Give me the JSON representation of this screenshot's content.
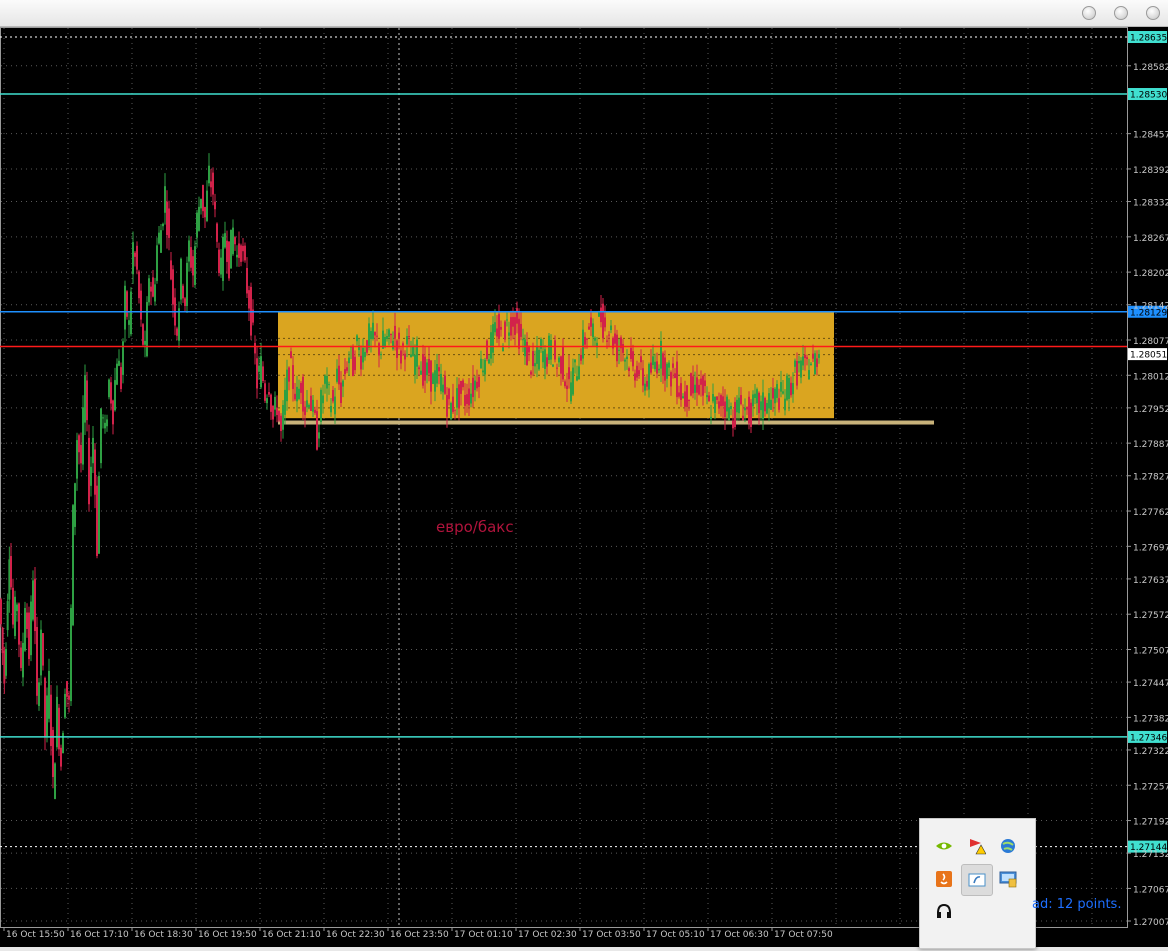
{
  "window": {
    "controls": [
      "minimize",
      "maximize",
      "close"
    ]
  },
  "chart_data": {
    "type": "candlestick",
    "symbol_label": "евро/бакс",
    "y_ticks": [
      "1.28582",
      "1.28457",
      "1.28392",
      "1.28332",
      "1.28267",
      "1.28202",
      "1.28142",
      "1.28077",
      "1.28012",
      "1.27952",
      "1.27887",
      "1.27827",
      "1.27762",
      "1.27697",
      "1.27637",
      "1.27572",
      "1.27507",
      "1.27447",
      "1.27382",
      "1.27322",
      "1.27257",
      "1.27192",
      "1.27132",
      "1.27067",
      "1.27007"
    ],
    "x_ticks": [
      "16 Oct 15:50",
      "16 Oct 17:10",
      "16 Oct 18:30",
      "16 Oct 19:50",
      "16 Oct 21:10",
      "16 Oct 22:30",
      "16 Oct 23:50",
      "17 Oct 01:10",
      "17 Oct 02:30",
      "17 Oct 03:50",
      "17 Oct 05:10",
      "17 Oct 06:30",
      "17 Oct 07:50"
    ],
    "ylim": [
      1.27007,
      1.2865
    ],
    "grid": true,
    "hlines": [
      {
        "price": 1.28635,
        "label": "1.28635",
        "color": "#ffffff",
        "style": "dotted",
        "box_color": "#40e0d0"
      },
      {
        "price": 1.2853,
        "label": "1.28530",
        "color": "#40e0d0",
        "style": "solid",
        "box_color": "#40e0d0"
      },
      {
        "price": 1.28129,
        "label": "1.28129",
        "color": "#1e90ff",
        "style": "solid",
        "box_color": "#1e90ff"
      },
      {
        "price": 1.28065,
        "label": "",
        "color": "#ff1a1a",
        "style": "solid",
        "box_color": ""
      },
      {
        "price": 1.28051,
        "label": "1.28051",
        "color": "#ffffff",
        "style": "none",
        "box_color": "#ffffff"
      },
      {
        "price": 1.27346,
        "label": "1.27346",
        "color": "#40e0d0",
        "style": "solid",
        "box_color": "#40e0d0"
      },
      {
        "price": 1.27144,
        "label": "1.27144",
        "color": "#ffffff",
        "style": "dotted",
        "box_color": "#40e0d0"
      }
    ],
    "range_box": {
      "price_top": 1.28129,
      "price_bottom": 1.27933,
      "color": "#daa520"
    },
    "range_box_extension": {
      "price": 1.27925,
      "color": "#c8b27a"
    },
    "candle_path": [
      [
        0,
        1.276
      ],
      [
        5,
        1.2745
      ],
      [
        10,
        1.277
      ],
      [
        14,
        1.2755
      ],
      [
        18,
        1.276
      ],
      [
        22,
        1.2745
      ],
      [
        26,
        1.276
      ],
      [
        30,
        1.275
      ],
      [
        34,
        1.2765
      ],
      [
        38,
        1.274
      ],
      [
        42,
        1.2755
      ],
      [
        46,
        1.2735
      ],
      [
        50,
        1.2745
      ],
      [
        54,
        1.2725
      ],
      [
        58,
        1.274
      ],
      [
        62,
        1.273
      ],
      [
        66,
        1.2745
      ],
      [
        70,
        1.274
      ],
      [
        74,
        1.2775
      ],
      [
        78,
        1.279
      ],
      [
        82,
        1.2785
      ],
      [
        86,
        1.28
      ],
      [
        90,
        1.278
      ],
      [
        94,
        1.279
      ],
      [
        98,
        1.277
      ],
      [
        102,
        1.2795
      ],
      [
        106,
        1.279
      ],
      [
        110,
        1.28
      ],
      [
        114,
        1.2795
      ],
      [
        118,
        1.2805
      ],
      [
        122,
        1.28
      ],
      [
        126,
        1.2815
      ],
      [
        130,
        1.281
      ],
      [
        134,
        1.2825
      ],
      [
        138,
        1.282
      ],
      [
        142,
        1.281
      ],
      [
        146,
        1.2805
      ],
      [
        150,
        1.282
      ],
      [
        154,
        1.2815
      ],
      [
        158,
        1.2825
      ],
      [
        162,
        1.2828
      ],
      [
        166,
        1.2835
      ],
      [
        170,
        1.2825
      ],
      [
        174,
        1.2815
      ],
      [
        178,
        1.281
      ],
      [
        182,
        1.282
      ],
      [
        186,
        1.2815
      ],
      [
        190,
        1.2825
      ],
      [
        194,
        1.282
      ],
      [
        198,
        1.283
      ],
      [
        202,
        1.2835
      ],
      [
        206,
        1.283
      ],
      [
        210,
        1.2838
      ],
      [
        214,
        1.2835
      ],
      [
        218,
        1.2825
      ],
      [
        222,
        1.282
      ],
      [
        226,
        1.2828
      ],
      [
        230,
        1.2822
      ],
      [
        234,
        1.2828
      ],
      [
        238,
        1.2823
      ],
      [
        242,
        1.2825
      ],
      [
        246,
        1.282
      ],
      [
        250,
        1.2815
      ],
      [
        254,
        1.2808
      ],
      [
        258,
        1.28
      ],
      [
        262,
        1.2803
      ],
      [
        266,
        1.2798
      ],
      [
        270,
        1.28
      ],
      [
        274,
        1.2793
      ],
      [
        278,
        1.2796
      ],
      [
        282,
        1.279
      ],
      [
        286,
        1.2797
      ],
      [
        290,
        1.2803
      ],
      [
        294,
        1.28
      ],
      [
        298,
        1.2797
      ],
      [
        302,
        1.28
      ],
      [
        306,
        1.2795
      ],
      [
        310,
        1.2798
      ],
      [
        314,
        1.2794
      ],
      [
        318,
        1.279
      ],
      [
        322,
        1.2796
      ],
      [
        326,
        1.28
      ],
      [
        330,
        1.2797
      ],
      [
        334,
        1.2796
      ],
      [
        338,
        1.2801
      ],
      [
        342,
        1.2798
      ],
      [
        346,
        1.2802
      ],
      [
        350,
        1.2805
      ],
      [
        354,
        1.2803
      ],
      [
        358,
        1.2807
      ],
      [
        362,
        1.2805
      ],
      [
        366,
        1.2807
      ],
      [
        370,
        1.2808
      ],
      [
        374,
        1.2808
      ],
      [
        378,
        1.2807
      ],
      [
        382,
        1.2806
      ],
      [
        386,
        1.2808
      ],
      [
        390,
        1.2807
      ],
      [
        394,
        1.2809
      ],
      [
        398,
        1.2807
      ],
      [
        402,
        1.2805
      ],
      [
        406,
        1.2807
      ],
      [
        410,
        1.2806
      ],
      [
        414,
        1.2804
      ],
      [
        418,
        1.2805
      ],
      [
        422,
        1.2803
      ],
      [
        426,
        1.2801
      ],
      [
        430,
        1.2802
      ],
      [
        434,
        1.28
      ],
      [
        438,
        1.2801
      ],
      [
        442,
        1.28
      ],
      [
        446,
        1.2798
      ],
      [
        450,
        1.2795
      ],
      [
        454,
        1.2796
      ],
      [
        458,
        1.2797
      ],
      [
        462,
        1.2798
      ],
      [
        466,
        1.2797
      ],
      [
        470,
        1.2798
      ],
      [
        474,
        1.2799
      ],
      [
        478,
        1.2801
      ],
      [
        482,
        1.2803
      ],
      [
        486,
        1.2805
      ],
      [
        490,
        1.2806
      ],
      [
        494,
        1.2808
      ],
      [
        498,
        1.281
      ],
      [
        502,
        1.2808
      ],
      [
        506,
        1.281
      ],
      [
        510,
        1.2811
      ],
      [
        514,
        1.2812
      ],
      [
        518,
        1.281
      ],
      [
        522,
        1.2808
      ],
      [
        526,
        1.2806
      ],
      [
        530,
        1.2804
      ],
      [
        534,
        1.2802
      ],
      [
        538,
        1.2804
      ],
      [
        542,
        1.2806
      ],
      [
        546,
        1.2804
      ],
      [
        550,
        1.2806
      ],
      [
        554,
        1.2805
      ],
      [
        558,
        1.2803
      ],
      [
        562,
        1.2804
      ],
      [
        566,
        1.2801
      ],
      [
        570,
        1.2799
      ],
      [
        574,
        1.2801
      ],
      [
        578,
        1.2803
      ],
      [
        582,
        1.2806
      ],
      [
        586,
        1.2808
      ],
      [
        590,
        1.281
      ],
      [
        594,
        1.2808
      ],
      [
        598,
        1.281
      ],
      [
        602,
        1.2812
      ],
      [
        606,
        1.281
      ],
      [
        610,
        1.281
      ],
      [
        614,
        1.2808
      ],
      [
        618,
        1.2806
      ],
      [
        622,
        1.2807
      ],
      [
        626,
        1.2805
      ],
      [
        630,
        1.2804
      ],
      [
        634,
        1.2802
      ],
      [
        638,
        1.2803
      ],
      [
        642,
        1.2801
      ],
      [
        646,
        1.28
      ],
      [
        650,
        1.2801
      ],
      [
        654,
        1.2803
      ],
      [
        658,
        1.2804
      ],
      [
        662,
        1.2805
      ],
      [
        666,
        1.2803
      ],
      [
        670,
        1.2801
      ],
      [
        674,
        1.2802
      ],
      [
        678,
        1.28
      ],
      [
        682,
        1.2798
      ],
      [
        686,
        1.2797
      ],
      [
        690,
        1.2799
      ],
      [
        694,
        1.2798
      ],
      [
        698,
        1.28
      ],
      [
        702,
        1.2799
      ],
      [
        706,
        1.2797
      ],
      [
        710,
        1.2795
      ],
      [
        714,
        1.2796
      ],
      [
        718,
        1.2795
      ],
      [
        722,
        1.2797
      ],
      [
        726,
        1.2796
      ],
      [
        730,
        1.2795
      ],
      [
        734,
        1.2794
      ],
      [
        738,
        1.2795
      ],
      [
        742,
        1.2796
      ],
      [
        746,
        1.2795
      ],
      [
        750,
        1.2794
      ],
      [
        754,
        1.2795
      ],
      [
        758,
        1.2796
      ],
      [
        762,
        1.2795
      ],
      [
        766,
        1.2796
      ],
      [
        770,
        1.2797
      ],
      [
        774,
        1.2796
      ],
      [
        778,
        1.2798
      ],
      [
        782,
        1.2797
      ],
      [
        786,
        1.2798
      ],
      [
        790,
        1.2799
      ],
      [
        794,
        1.2801
      ],
      [
        798,
        1.2802
      ],
      [
        802,
        1.2803
      ],
      [
        806,
        1.2802
      ],
      [
        810,
        1.2804
      ],
      [
        814,
        1.2803
      ],
      [
        818,
        1.2805
      ],
      [
        820,
        1.2806
      ]
    ]
  },
  "tray": {
    "icons": [
      "nvidia-icon",
      "warning-flag-icon",
      "network-globe-icon",
      "java-icon",
      "utility-window-icon",
      "display-settings-icon",
      "headset-icon"
    ]
  },
  "status": {
    "spread_text": "ad: 12 points."
  }
}
